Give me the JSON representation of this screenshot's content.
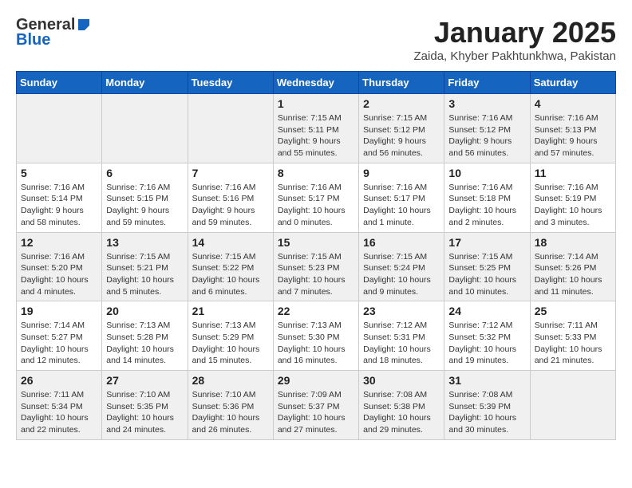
{
  "header": {
    "logo_general": "General",
    "logo_blue": "Blue",
    "title": "January 2025",
    "subtitle": "Zaida, Khyber Pakhtunkhwa, Pakistan"
  },
  "weekdays": [
    "Sunday",
    "Monday",
    "Tuesday",
    "Wednesday",
    "Thursday",
    "Friday",
    "Saturday"
  ],
  "weeks": [
    [
      {
        "day": "",
        "info": ""
      },
      {
        "day": "",
        "info": ""
      },
      {
        "day": "",
        "info": ""
      },
      {
        "day": "1",
        "info": "Sunrise: 7:15 AM\nSunset: 5:11 PM\nDaylight: 9 hours and 55 minutes."
      },
      {
        "day": "2",
        "info": "Sunrise: 7:15 AM\nSunset: 5:12 PM\nDaylight: 9 hours and 56 minutes."
      },
      {
        "day": "3",
        "info": "Sunrise: 7:16 AM\nSunset: 5:12 PM\nDaylight: 9 hours and 56 minutes."
      },
      {
        "day": "4",
        "info": "Sunrise: 7:16 AM\nSunset: 5:13 PM\nDaylight: 9 hours and 57 minutes."
      }
    ],
    [
      {
        "day": "5",
        "info": "Sunrise: 7:16 AM\nSunset: 5:14 PM\nDaylight: 9 hours and 58 minutes."
      },
      {
        "day": "6",
        "info": "Sunrise: 7:16 AM\nSunset: 5:15 PM\nDaylight: 9 hours and 59 minutes."
      },
      {
        "day": "7",
        "info": "Sunrise: 7:16 AM\nSunset: 5:16 PM\nDaylight: 9 hours and 59 minutes."
      },
      {
        "day": "8",
        "info": "Sunrise: 7:16 AM\nSunset: 5:17 PM\nDaylight: 10 hours and 0 minutes."
      },
      {
        "day": "9",
        "info": "Sunrise: 7:16 AM\nSunset: 5:17 PM\nDaylight: 10 hours and 1 minute."
      },
      {
        "day": "10",
        "info": "Sunrise: 7:16 AM\nSunset: 5:18 PM\nDaylight: 10 hours and 2 minutes."
      },
      {
        "day": "11",
        "info": "Sunrise: 7:16 AM\nSunset: 5:19 PM\nDaylight: 10 hours and 3 minutes."
      }
    ],
    [
      {
        "day": "12",
        "info": "Sunrise: 7:16 AM\nSunset: 5:20 PM\nDaylight: 10 hours and 4 minutes."
      },
      {
        "day": "13",
        "info": "Sunrise: 7:15 AM\nSunset: 5:21 PM\nDaylight: 10 hours and 5 minutes."
      },
      {
        "day": "14",
        "info": "Sunrise: 7:15 AM\nSunset: 5:22 PM\nDaylight: 10 hours and 6 minutes."
      },
      {
        "day": "15",
        "info": "Sunrise: 7:15 AM\nSunset: 5:23 PM\nDaylight: 10 hours and 7 minutes."
      },
      {
        "day": "16",
        "info": "Sunrise: 7:15 AM\nSunset: 5:24 PM\nDaylight: 10 hours and 9 minutes."
      },
      {
        "day": "17",
        "info": "Sunrise: 7:15 AM\nSunset: 5:25 PM\nDaylight: 10 hours and 10 minutes."
      },
      {
        "day": "18",
        "info": "Sunrise: 7:14 AM\nSunset: 5:26 PM\nDaylight: 10 hours and 11 minutes."
      }
    ],
    [
      {
        "day": "19",
        "info": "Sunrise: 7:14 AM\nSunset: 5:27 PM\nDaylight: 10 hours and 12 minutes."
      },
      {
        "day": "20",
        "info": "Sunrise: 7:13 AM\nSunset: 5:28 PM\nDaylight: 10 hours and 14 minutes."
      },
      {
        "day": "21",
        "info": "Sunrise: 7:13 AM\nSunset: 5:29 PM\nDaylight: 10 hours and 15 minutes."
      },
      {
        "day": "22",
        "info": "Sunrise: 7:13 AM\nSunset: 5:30 PM\nDaylight: 10 hours and 16 minutes."
      },
      {
        "day": "23",
        "info": "Sunrise: 7:12 AM\nSunset: 5:31 PM\nDaylight: 10 hours and 18 minutes."
      },
      {
        "day": "24",
        "info": "Sunrise: 7:12 AM\nSunset: 5:32 PM\nDaylight: 10 hours and 19 minutes."
      },
      {
        "day": "25",
        "info": "Sunrise: 7:11 AM\nSunset: 5:33 PM\nDaylight: 10 hours and 21 minutes."
      }
    ],
    [
      {
        "day": "26",
        "info": "Sunrise: 7:11 AM\nSunset: 5:34 PM\nDaylight: 10 hours and 22 minutes."
      },
      {
        "day": "27",
        "info": "Sunrise: 7:10 AM\nSunset: 5:35 PM\nDaylight: 10 hours and 24 minutes."
      },
      {
        "day": "28",
        "info": "Sunrise: 7:10 AM\nSunset: 5:36 PM\nDaylight: 10 hours and 26 minutes."
      },
      {
        "day": "29",
        "info": "Sunrise: 7:09 AM\nSunset: 5:37 PM\nDaylight: 10 hours and 27 minutes."
      },
      {
        "day": "30",
        "info": "Sunrise: 7:08 AM\nSunset: 5:38 PM\nDaylight: 10 hours and 29 minutes."
      },
      {
        "day": "31",
        "info": "Sunrise: 7:08 AM\nSunset: 5:39 PM\nDaylight: 10 hours and 30 minutes."
      },
      {
        "day": "",
        "info": ""
      }
    ]
  ]
}
